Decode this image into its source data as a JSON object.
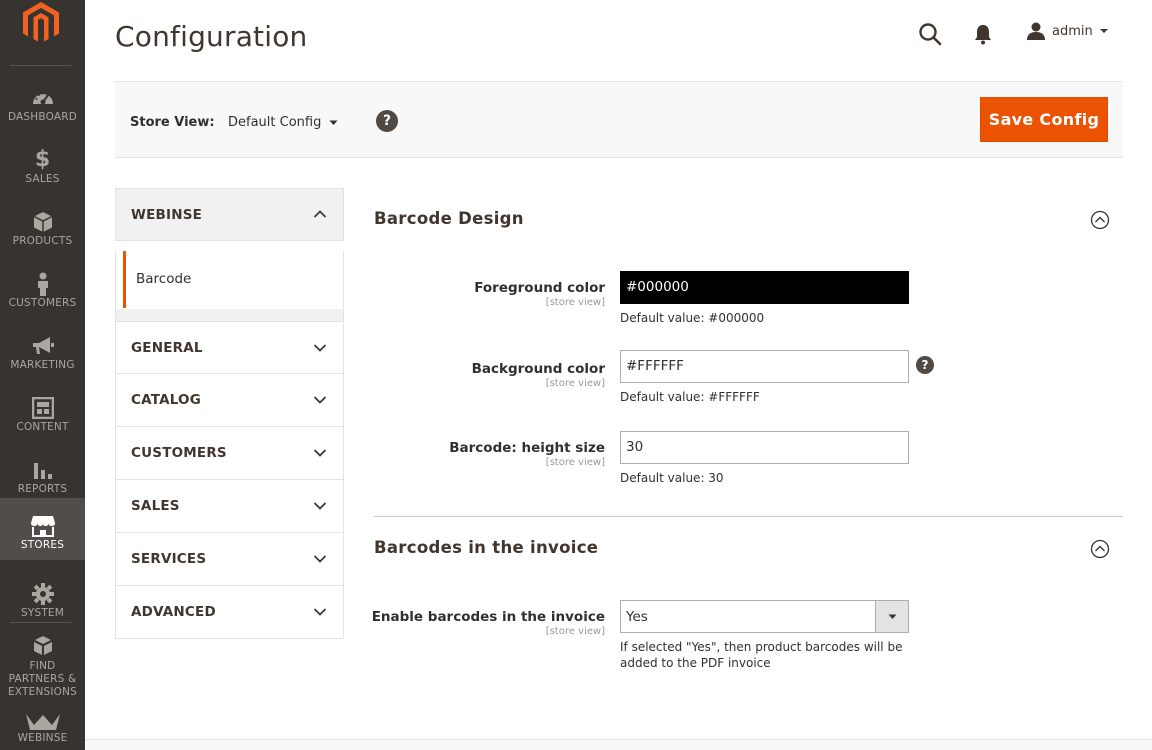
{
  "nav": {
    "items": [
      {
        "label": "DASHBOARD",
        "icon": "dashboard-icon"
      },
      {
        "label": "SALES",
        "icon": "dollar-icon"
      },
      {
        "label": "PRODUCTS",
        "icon": "box-icon"
      },
      {
        "label": "CUSTOMERS",
        "icon": "person-icon"
      },
      {
        "label": "MARKETING",
        "icon": "megaphone-icon"
      },
      {
        "label": "CONTENT",
        "icon": "layout-icon"
      },
      {
        "label": "REPORTS",
        "icon": "bar-chart-icon"
      },
      {
        "label": "STORES",
        "icon": "store-icon"
      },
      {
        "label": "SYSTEM",
        "icon": "gear-icon"
      },
      {
        "label": "FIND PARTNERS & EXTENSIONS",
        "icon": "blocks-icon"
      },
      {
        "label": "WEBINSE",
        "icon": "webinse-crown-icon"
      }
    ],
    "active": "STORES"
  },
  "header": {
    "title": "Configuration",
    "user": "admin"
  },
  "toolbar": {
    "store_view_label": "Store View:",
    "store_view_value": "Default Config",
    "help": "?",
    "save_label": "Save Config"
  },
  "tabs": {
    "open_group": "WEBINSE",
    "open_item": "Barcode",
    "groups": [
      "GENERAL",
      "CATALOG",
      "CUSTOMERS",
      "SALES",
      "SERVICES",
      "ADVANCED"
    ]
  },
  "sections": {
    "design": {
      "title": "Barcode Design",
      "fields": {
        "foreground": {
          "label": "Foreground color",
          "scope": "[store view]",
          "value": "#000000",
          "note": "Default value: #000000"
        },
        "background": {
          "label": "Background color",
          "scope": "[store view]",
          "value": "#FFFFFF",
          "note": "Default value: #FFFFFF",
          "help": "?"
        },
        "height": {
          "label": "Barcode: height size",
          "scope": "[store view]",
          "value": "30",
          "note": "Default value: 30"
        }
      }
    },
    "invoice": {
      "title": "Barcodes in the invoice",
      "fields": {
        "enable": {
          "label": "Enable barcodes in the invoice",
          "scope": "[store view]",
          "value": "Yes",
          "note_line1": "If selected \"Yes\", then product barcodes will be",
          "note_line2": "added to the PDF invoice"
        }
      }
    }
  },
  "colors": {
    "accent": "#eb5202",
    "nav_bg": "#373330",
    "nav_active": "#524d49"
  }
}
